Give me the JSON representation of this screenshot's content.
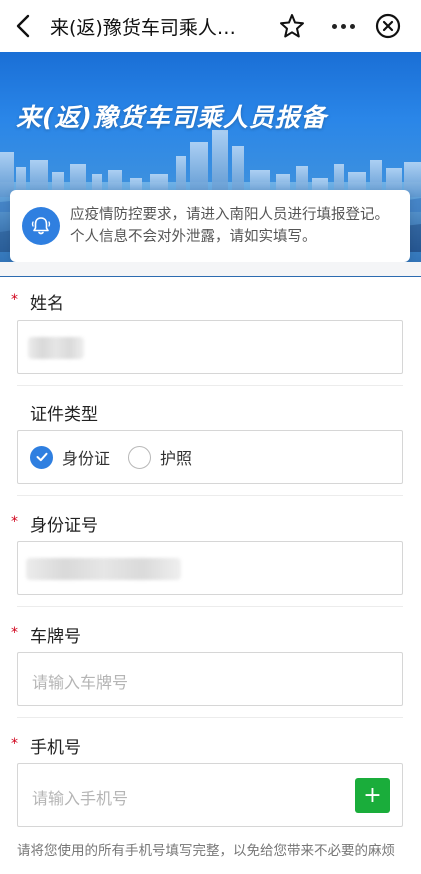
{
  "nav": {
    "title": "来(返)豫货车司乘人…",
    "back_icon": "chevron-left-icon",
    "star_icon": "star-icon",
    "more_icon": "more-icon",
    "close_icon": "close-circle-icon"
  },
  "banner": {
    "title": "来(返)豫货车司乘人员报备"
  },
  "notice": {
    "icon": "bell-icon",
    "text": "应疫情防控要求，请进入南阳人员进行填报登记。个人信息不会对外泄露，请如实填写。"
  },
  "form": {
    "name": {
      "label": "姓名",
      "required": "*",
      "value": ""
    },
    "id_type": {
      "label": "证件类型",
      "options": [
        {
          "label": "身份证",
          "checked": true
        },
        {
          "label": "护照",
          "checked": false
        }
      ]
    },
    "id_number": {
      "label": "身份证号",
      "required": "*",
      "value": ""
    },
    "plate": {
      "label": "车牌号",
      "required": "*",
      "placeholder": "请输入车牌号"
    },
    "phone": {
      "label": "手机号",
      "required": "*",
      "placeholder": "请输入手机号",
      "add_label": "+"
    },
    "hint": "请将您使用的所有手机号填写完整，以免给您带来不必要的麻烦"
  },
  "colors": {
    "accent": "#2f7fe0",
    "required": "#d0021b",
    "add_button": "#1aad3b"
  }
}
